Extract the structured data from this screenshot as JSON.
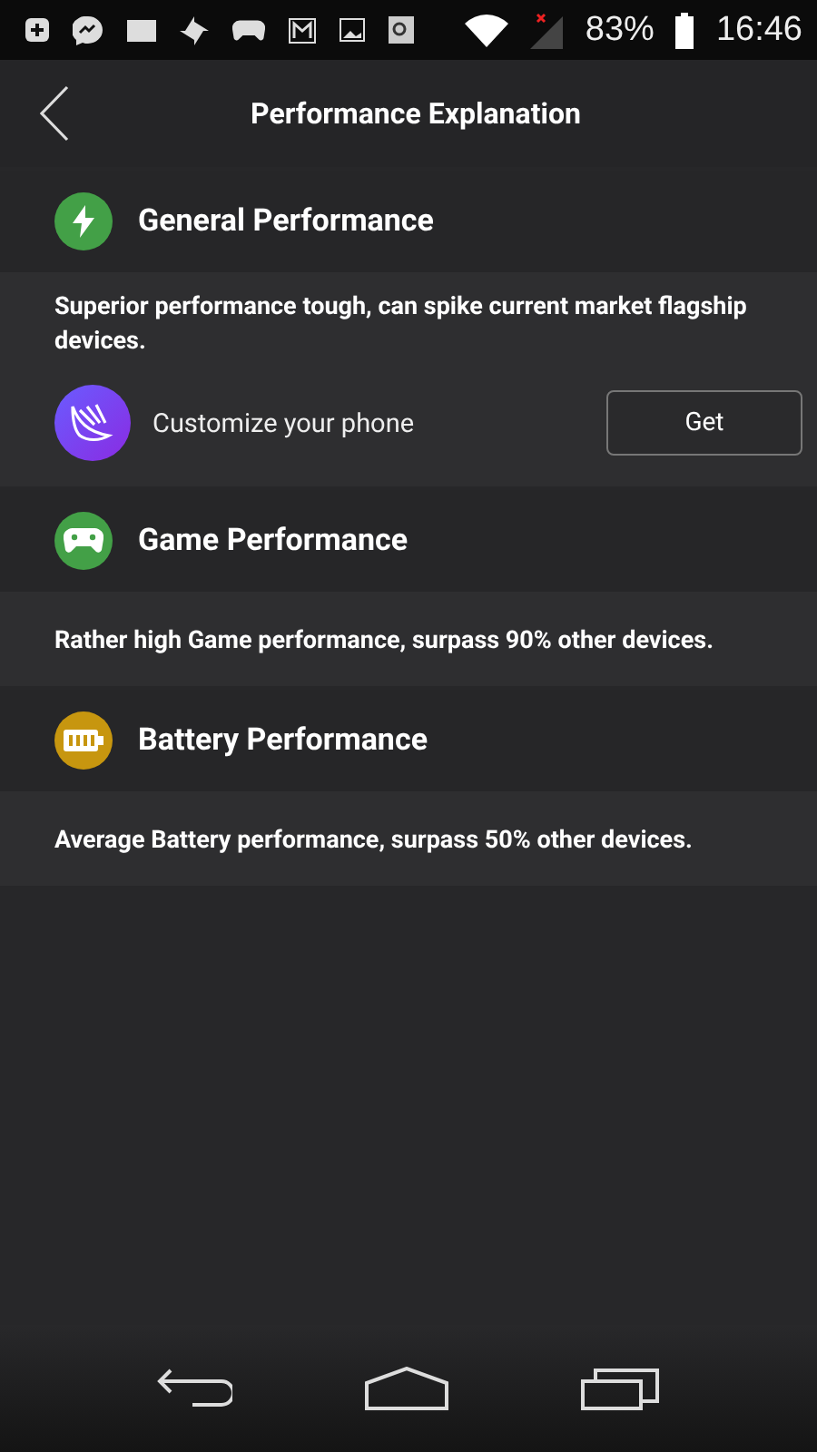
{
  "status_bar": {
    "battery": "83%",
    "time": "16:46"
  },
  "header": {
    "title": "Performance Explanation"
  },
  "sections": [
    {
      "kind": "bolt",
      "color": "#43a047",
      "title": "General Performance",
      "description": "Superior performance tough, can spike current market flagship devices.",
      "promo": {
        "label": "Customize your phone",
        "button": "Get"
      }
    },
    {
      "kind": "gamepad",
      "color": "#43a047",
      "title": "Game Performance",
      "description": "Rather high Game performance, surpass 90% other devices."
    },
    {
      "kind": "battery",
      "color": "#c7960f",
      "title": "Battery Performance",
      "description": "Average Battery performance, surpass 50% other devices."
    }
  ]
}
